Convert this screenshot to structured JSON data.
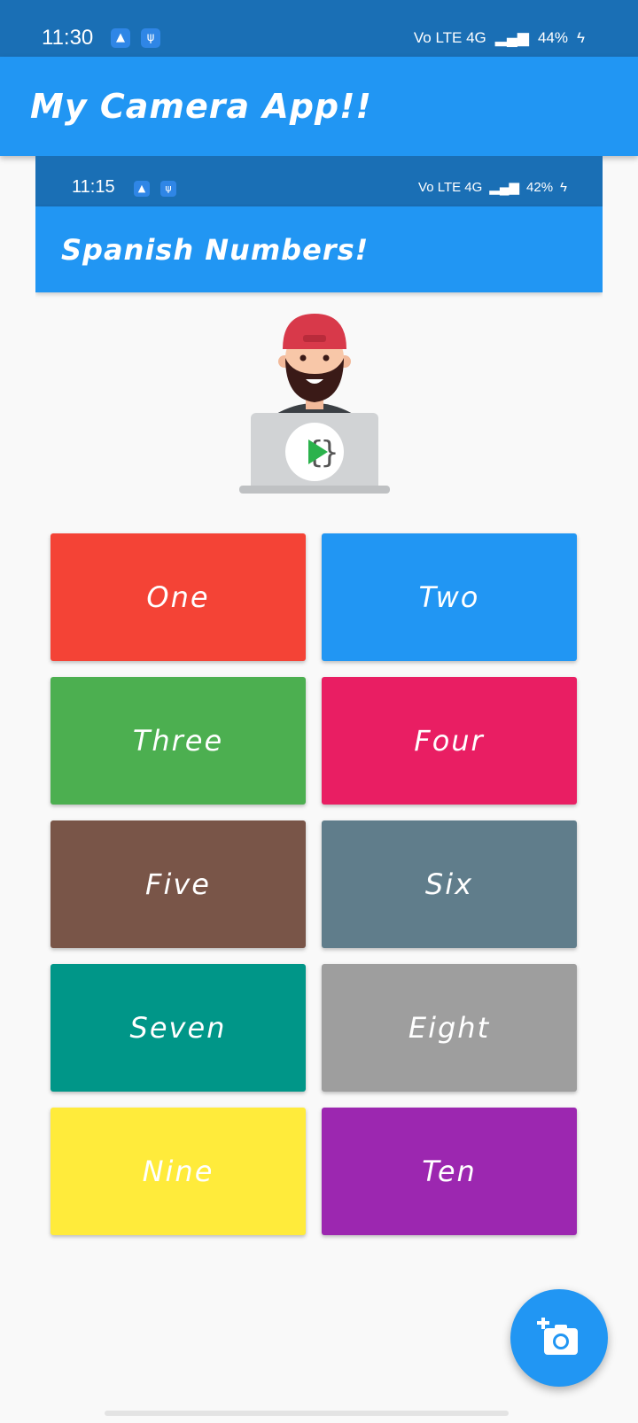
{
  "status_bar": {
    "time": "11:30",
    "network": "Vo LTE 4G",
    "battery": "44%"
  },
  "app_bar": {
    "title": "My Camera App!!"
  },
  "embedded_screenshot": {
    "status_bar": {
      "time": "11:15",
      "network": "Vo LTE 4G",
      "battery": "42%"
    },
    "app_bar": {
      "title": "Spanish Numbers!"
    },
    "buttons": [
      {
        "label": "One",
        "color": "#f44336"
      },
      {
        "label": "Two",
        "color": "#2196f3"
      },
      {
        "label": "Three",
        "color": "#4caf50"
      },
      {
        "label": "Four",
        "color": "#e91e63"
      },
      {
        "label": "Five",
        "color": "#795548"
      },
      {
        "label": "Six",
        "color": "#607d8b"
      },
      {
        "label": "Seven",
        "color": "#009688"
      },
      {
        "label": "Eight",
        "color": "#9e9e9e"
      },
      {
        "label": "Nine",
        "color": "#ffeb3b"
      },
      {
        "label": "Ten",
        "color": "#9c27b0"
      }
    ]
  },
  "fab": {
    "icon": "add-camera-icon"
  }
}
